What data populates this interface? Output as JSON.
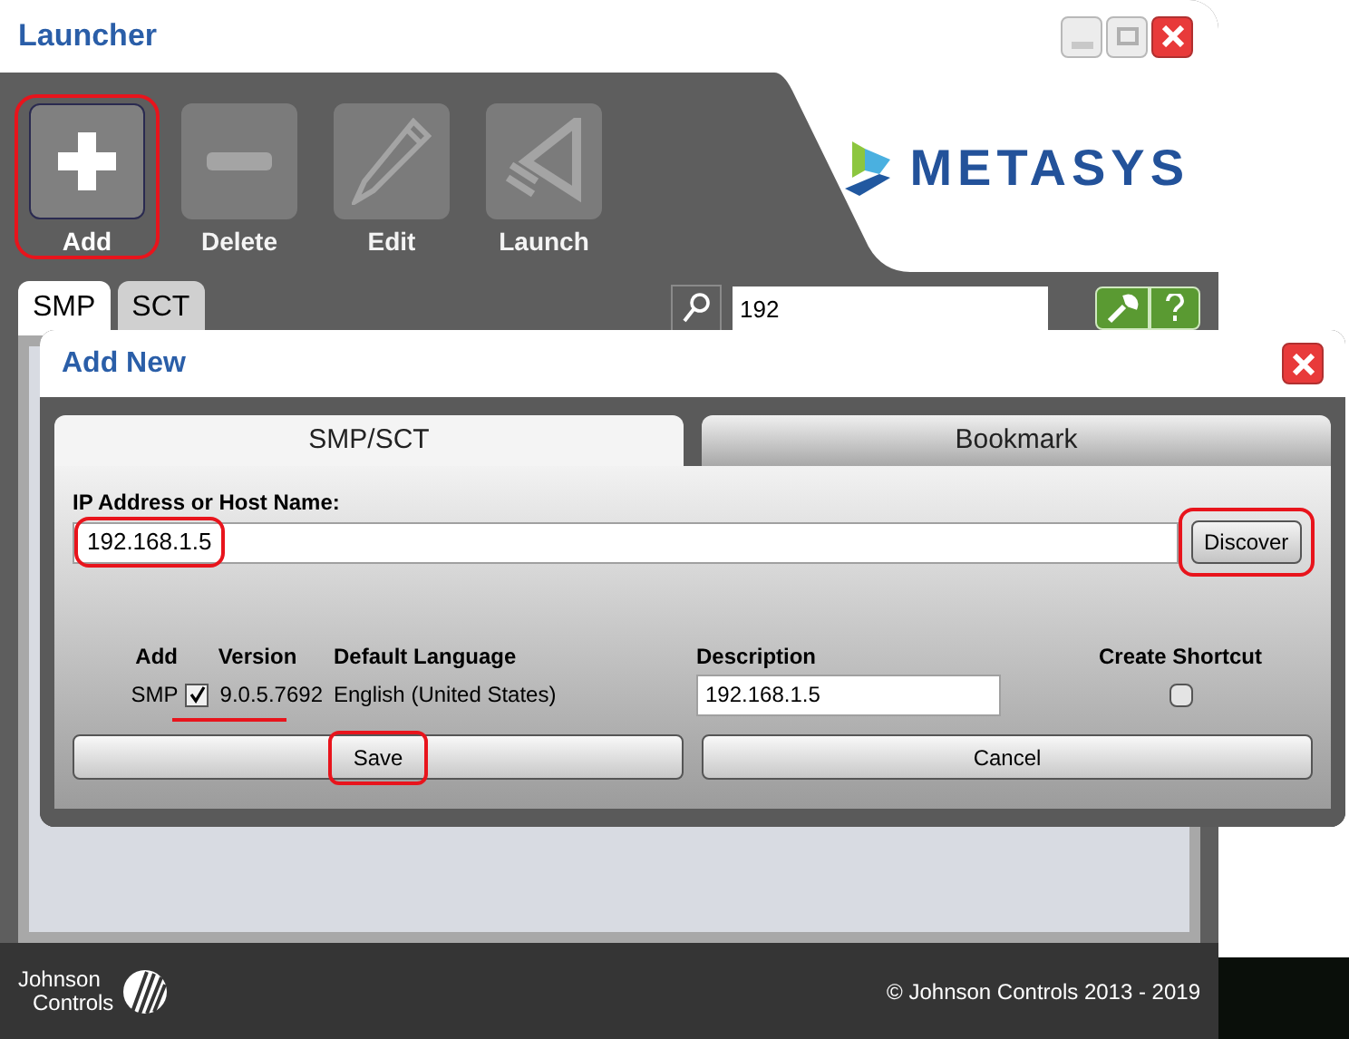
{
  "window": {
    "title": "Launcher"
  },
  "toolbar": [
    {
      "label": "Add",
      "kind": "add",
      "disabled": false,
      "highlighted": true
    },
    {
      "label": "Delete",
      "kind": "delete",
      "disabled": true,
      "highlighted": false
    },
    {
      "label": "Edit",
      "kind": "edit",
      "disabled": true,
      "highlighted": false
    },
    {
      "label": "Launch",
      "kind": "launch",
      "disabled": true,
      "highlighted": false
    }
  ],
  "logo_text": "METASYS",
  "tabs": [
    {
      "label": "SMP",
      "selected": true
    },
    {
      "label": "SCT",
      "selected": false
    }
  ],
  "search": {
    "value": "192"
  },
  "footer": {
    "logo_line_1": "Johnson",
    "logo_line_2": "Controls",
    "copyright": "© Johnson Controls 2013 - 2019"
  },
  "dialog": {
    "title": "Add New",
    "tabs": [
      {
        "label": "SMP/SCT",
        "selected": true
      },
      {
        "label": "Bookmark",
        "selected": false
      }
    ],
    "ip_label": "IP Address or Host Name:",
    "ip_value": "192.168.1.5",
    "ip_highlighted": true,
    "discover": {
      "label": "Discover",
      "highlighted": true
    },
    "columns": [
      "Add",
      "Version",
      "Default Language",
      "Description",
      "Create Shortcut"
    ],
    "row": {
      "type": "SMP",
      "add_checked": true,
      "version": "9.0.5.7692",
      "language": "English (United States)",
      "description": "192.168.1.5",
      "create_shortcut": false,
      "underlined": true
    },
    "buttons": [
      {
        "label": "Save",
        "highlighted": true
      },
      {
        "label": "Cancel",
        "highlighted": false
      }
    ]
  }
}
